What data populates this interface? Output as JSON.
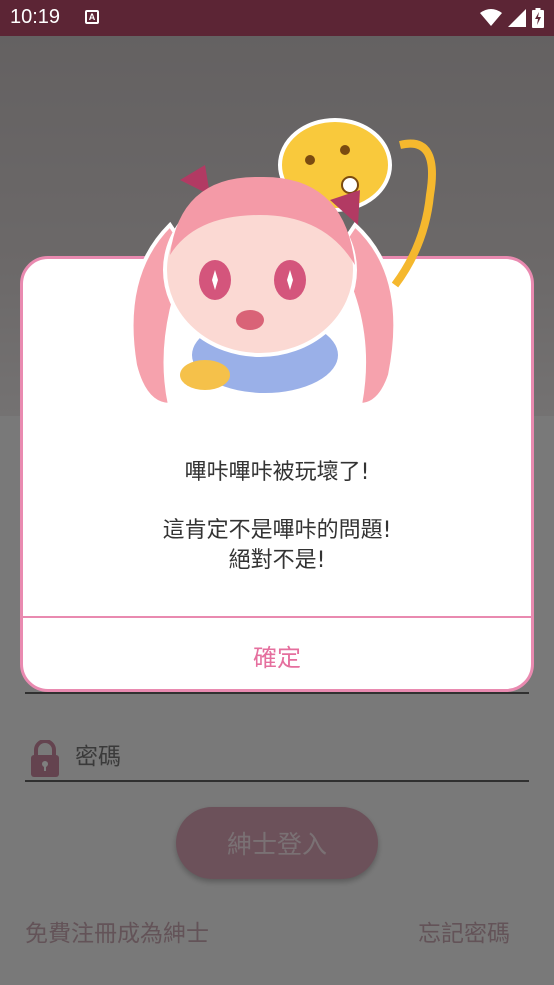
{
  "status_bar": {
    "time": "10:19",
    "notification_glyph": "A"
  },
  "form": {
    "password_placeholder": "密碼",
    "login_button": "紳士登入",
    "register_link": "免費注冊成為紳士",
    "forgot_link": "忘記密碼"
  },
  "dialog": {
    "line1": "嗶咔嗶咔被玩壞了!",
    "line2": "這肯定不是嗶咔的問題!",
    "line3": "絕對不是!",
    "confirm_button": "確定"
  },
  "colors": {
    "accent": "#e98ab0",
    "status_bar": "#5c2535",
    "button_text": "#e56f9e"
  },
  "icons": [
    "wifi-icon",
    "signal-icon",
    "battery-icon",
    "lock-icon"
  ]
}
